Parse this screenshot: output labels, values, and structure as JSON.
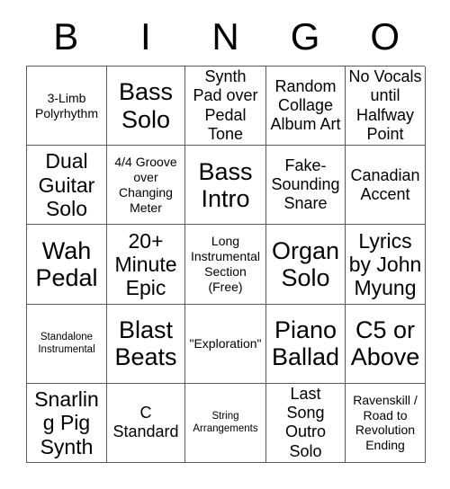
{
  "card": {
    "header_letters": [
      "B",
      "I",
      "N",
      "G",
      "O"
    ],
    "columns": 5,
    "rows": 5,
    "colors": {
      "background": "#ffffff",
      "grid_line": "#5a5a5a",
      "text": "#000000"
    },
    "cells": [
      {
        "text": "3-Limb Polyrhythm",
        "size": "sm"
      },
      {
        "text": "Bass Solo",
        "size": "xl"
      },
      {
        "text": "Synth Pad over Pedal Tone",
        "size": "md"
      },
      {
        "text": "Random Collage Album Art",
        "size": "md"
      },
      {
        "text": "No Vocals until Halfway Point",
        "size": "md"
      },
      {
        "text": "Dual Guitar Solo",
        "size": "lg"
      },
      {
        "text": "4/4 Groove over Changing Meter",
        "size": "sm"
      },
      {
        "text": "Bass Intro",
        "size": "xl"
      },
      {
        "text": "Fake-Sounding Snare",
        "size": "md"
      },
      {
        "text": "Canadian Accent",
        "size": "md"
      },
      {
        "text": "Wah Pedal",
        "size": "xl"
      },
      {
        "text": "20+ Minute Epic",
        "size": "lg"
      },
      {
        "text": "Long Instrumental Section (Free)",
        "size": "sm"
      },
      {
        "text": "Organ Solo",
        "size": "xl"
      },
      {
        "text": "Lyrics by John Myung",
        "size": "lg"
      },
      {
        "text": "Standalone Instrumental",
        "size": "xs"
      },
      {
        "text": "Blast Beats",
        "size": "xl"
      },
      {
        "text": "\"Exploration\"",
        "size": "sm"
      },
      {
        "text": "Piano Ballad",
        "size": "xl"
      },
      {
        "text": "C5 or Above",
        "size": "xl"
      },
      {
        "text": "Snarling Pig Synth",
        "size": "lg"
      },
      {
        "text": "C Standard",
        "size": "md"
      },
      {
        "text": "String Arrangements",
        "size": "xs"
      },
      {
        "text": "Last Song Outro Solo",
        "size": "md"
      },
      {
        "text": "Ravenskill / Road to Revolution Ending",
        "size": "sm"
      }
    ]
  }
}
